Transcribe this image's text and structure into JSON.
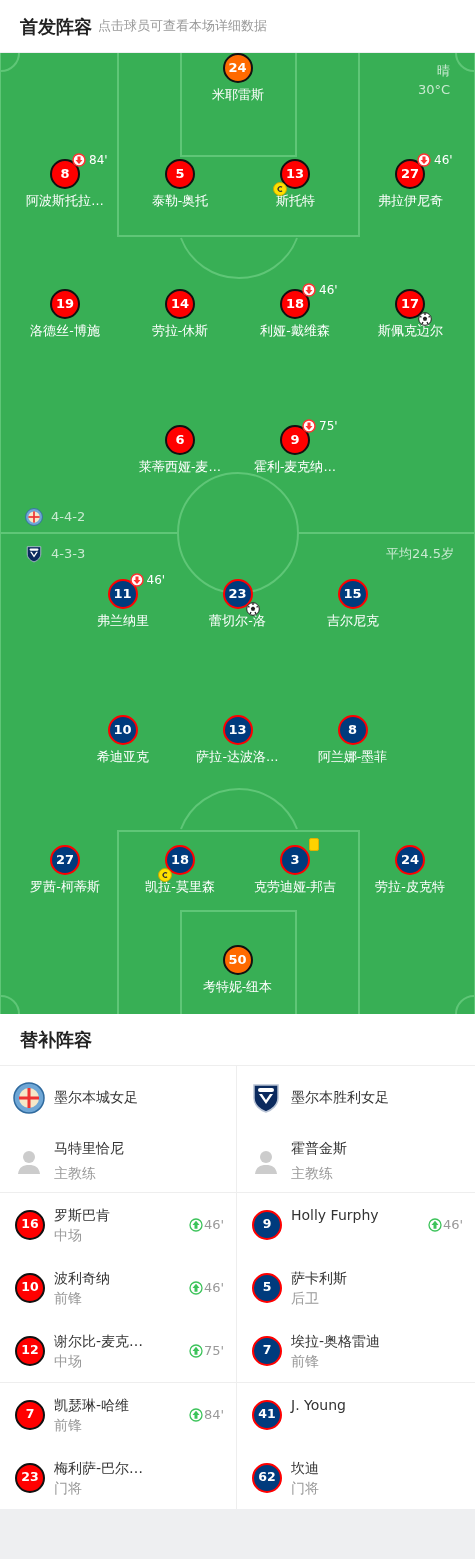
{
  "header": {
    "title": "首发阵容",
    "hint": "点击球员可查看本场详细数据"
  },
  "weather": {
    "condition": "晴",
    "temperature": "30°C"
  },
  "lineups": [
    {
      "kind": "home",
      "formation": "4-4-2",
      "lines": [
        {
          "players": [
            {
              "number": "24",
              "name": "米耶雷斯",
              "goalkeeper": true,
              "captain": false,
              "goal": false,
              "yellow_card": false
            }
          ]
        },
        {
          "players": [
            {
              "number": "8",
              "name": "阿波斯托拉…",
              "goalkeeper": false,
              "captain": false,
              "goal": false,
              "yellow_card": false,
              "sub_off": "84'"
            },
            {
              "number": "5",
              "name": "泰勒-奥托",
              "goalkeeper": false,
              "captain": false,
              "goal": false,
              "yellow_card": false
            },
            {
              "number": "13",
              "name": "斯托特",
              "goalkeeper": false,
              "captain": true,
              "goal": false,
              "yellow_card": false
            },
            {
              "number": "27",
              "name": "弗拉伊尼奇",
              "goalkeeper": false,
              "captain": false,
              "goal": false,
              "yellow_card": false,
              "sub_off": "46'"
            }
          ]
        },
        {
          "players": [
            {
              "number": "19",
              "name": "洛德丝-博施",
              "goalkeeper": false,
              "captain": false,
              "goal": false,
              "yellow_card": false
            },
            {
              "number": "14",
              "name": "劳拉-休斯",
              "goalkeeper": false,
              "captain": false,
              "goal": false,
              "yellow_card": false
            },
            {
              "number": "18",
              "name": "利娅-戴维森",
              "goalkeeper": false,
              "captain": false,
              "goal": false,
              "yellow_card": false,
              "sub_off": "46'"
            },
            {
              "number": "17",
              "name": "斯佩克迈尔",
              "goalkeeper": false,
              "captain": false,
              "goal": true,
              "yellow_card": false
            }
          ]
        },
        {
          "players": [
            {
              "number": "6",
              "name": "莱蒂西娅-麦…",
              "goalkeeper": false,
              "captain": false,
              "goal": false,
              "yellow_card": false
            },
            {
              "number": "9",
              "name": "霍利-麦克纳…",
              "goalkeeper": false,
              "captain": false,
              "goal": false,
              "yellow_card": false,
              "sub_off": "75'"
            }
          ]
        }
      ]
    },
    {
      "kind": "away",
      "formation": "4-3-3",
      "average_age": "平均24.5岁",
      "lines": [
        {
          "players": [
            {
              "number": "11",
              "name": "弗兰纳里",
              "goalkeeper": false,
              "captain": false,
              "goal": false,
              "yellow_card": false,
              "sub_off": "46'"
            },
            {
              "number": "23",
              "name": "蕾切尔-洛",
              "goalkeeper": false,
              "captain": false,
              "goal": true,
              "yellow_card": false
            },
            {
              "number": "15",
              "name": "吉尔尼克",
              "goalkeeper": false,
              "captain": false,
              "goal": false,
              "yellow_card": false
            }
          ]
        },
        {
          "players": [
            {
              "number": "10",
              "name": "希迪亚克",
              "goalkeeper": false,
              "captain": false,
              "goal": false,
              "yellow_card": false
            },
            {
              "number": "13",
              "name": "萨拉-达波洛…",
              "goalkeeper": false,
              "captain": false,
              "goal": false,
              "yellow_card": false
            },
            {
              "number": "8",
              "name": "阿兰娜-墨菲",
              "goalkeeper": false,
              "captain": false,
              "goal": false,
              "yellow_card": false
            }
          ]
        },
        {
          "players": [
            {
              "number": "27",
              "name": "罗茜-柯蒂斯",
              "goalkeeper": false,
              "captain": false,
              "goal": false,
              "yellow_card": false
            },
            {
              "number": "18",
              "name": "凯拉-莫里森",
              "goalkeeper": false,
              "captain": true,
              "goal": false,
              "yellow_card": false
            },
            {
              "number": "3",
              "name": "克劳迪娅-邦吉",
              "goalkeeper": false,
              "captain": false,
              "goal": false,
              "yellow_card": true
            },
            {
              "number": "24",
              "name": "劳拉-皮克特",
              "goalkeeper": false,
              "captain": false,
              "goal": false,
              "yellow_card": false
            }
          ]
        },
        {
          "players": [
            {
              "number": "50",
              "name": "考特妮-纽本",
              "goalkeeper": true,
              "captain": false,
              "goal": false,
              "yellow_card": false
            }
          ]
        }
      ]
    }
  ],
  "substitutes": {
    "title": "替补阵容",
    "teams": [
      {
        "kind": "home",
        "name": "墨尔本城女足",
        "coach": {
          "name": "马特里恰尼",
          "role": "主教练"
        },
        "players": [
          {
            "number": "16",
            "name": "罗斯巴肯",
            "position": "中场",
            "sub_on": "46'"
          },
          {
            "number": "10",
            "name": "波利奇纳",
            "position": "前锋",
            "sub_on": "46'"
          },
          {
            "number": "12",
            "name": "谢尔比-麦克…",
            "position": "中场",
            "sub_on": "75'"
          },
          {
            "number": "7",
            "name": "凯瑟琳-哈维",
            "position": "前锋",
            "sub_on": "84'"
          },
          {
            "number": "23",
            "name": "梅利萨-巴尔…",
            "position": "门将"
          }
        ]
      },
      {
        "kind": "away",
        "name": "墨尔本胜利女足",
        "coach": {
          "name": "霍普金斯",
          "role": "主教练"
        },
        "players": [
          {
            "number": "9",
            "name": "Holly Furphy",
            "sub_on": "46'"
          },
          {
            "number": "5",
            "name": "萨卡利斯",
            "position": "后卫"
          },
          {
            "number": "7",
            "name": "埃拉-奥格雷迪",
            "position": "前锋"
          },
          {
            "number": "41",
            "name": "J. Young"
          },
          {
            "number": "62",
            "name": "坎迪",
            "position": "门将"
          }
        ]
      }
    ]
  }
}
